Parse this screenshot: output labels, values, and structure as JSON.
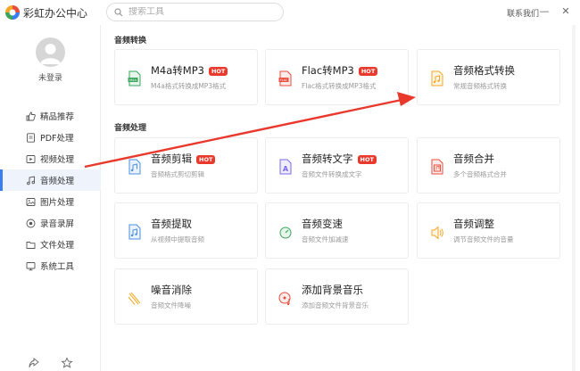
{
  "app": {
    "title": "彩虹办公中心"
  },
  "search": {
    "placeholder": "搜索工具"
  },
  "header": {
    "contact": "联系我们",
    "minimize": "—",
    "close": "✕"
  },
  "user": {
    "login": "未登录"
  },
  "sidebar": {
    "items": [
      {
        "label": "精品推荐",
        "icon": "thumbs-up-icon"
      },
      {
        "label": "PDF处理",
        "icon": "pdf-icon"
      },
      {
        "label": "视频处理",
        "icon": "video-icon"
      },
      {
        "label": "音频处理",
        "icon": "music-icon",
        "active": true
      },
      {
        "label": "图片处理",
        "icon": "image-icon"
      },
      {
        "label": "录音录屏",
        "icon": "record-icon"
      },
      {
        "label": "文件处理",
        "icon": "folder-icon"
      },
      {
        "label": "系统工具",
        "icon": "system-icon"
      }
    ]
  },
  "sections": {
    "convert": {
      "title": "音频转换"
    },
    "process": {
      "title": "音频处理"
    }
  },
  "cards": [
    {
      "title": "M4a转MP3",
      "hot": "HOT",
      "desc": "M4a格式转换成MP3格式",
      "icon": "m4a-icon",
      "color": "#3aa55d"
    },
    {
      "title": "Flac转MP3",
      "hot": "HOT",
      "desc": "Flac格式转换成MP3格式",
      "icon": "flac-icon",
      "color": "#e84c3d"
    },
    {
      "title": "音频格式转换",
      "hot": "",
      "desc": "常规音频格式转换",
      "icon": "audio-convert-icon",
      "color": "#f5a623"
    },
    {
      "title": "音频剪辑",
      "hot": "HOT",
      "desc": "音频格式剪切剪辑",
      "icon": "audio-cut-icon",
      "color": "#4a90e2"
    },
    {
      "title": "音频转文字",
      "hot": "HOT",
      "desc": "音频文件转换成文字",
      "icon": "audio-to-text-icon",
      "color": "#7b68ee"
    },
    {
      "title": "音频合并",
      "hot": "",
      "desc": "多个音频格式合并",
      "icon": "audio-merge-icon",
      "color": "#e84c3d"
    },
    {
      "title": "音频提取",
      "hot": "",
      "desc": "从视频中提取音频",
      "icon": "audio-extract-icon",
      "color": "#4a90e2"
    },
    {
      "title": "音频变速",
      "hot": "",
      "desc": "音频文件加减速",
      "icon": "audio-speed-icon",
      "color": "#3aa55d"
    },
    {
      "title": "音频调整",
      "hot": "",
      "desc": "调节音频文件的音量",
      "icon": "volume-icon",
      "color": "#f5a623"
    },
    {
      "title": "噪音消除",
      "hot": "",
      "desc": "音频文件降噪",
      "icon": "noise-icon",
      "color": "#f5a623"
    },
    {
      "title": "添加背景音乐",
      "hot": "",
      "desc": "添加音频文件背景音乐",
      "icon": "bgm-icon",
      "color": "#e84c3d"
    }
  ],
  "colors": {
    "accent": "#3b7ef0",
    "hot": "#e8392c",
    "arrow": "#e8392c"
  }
}
